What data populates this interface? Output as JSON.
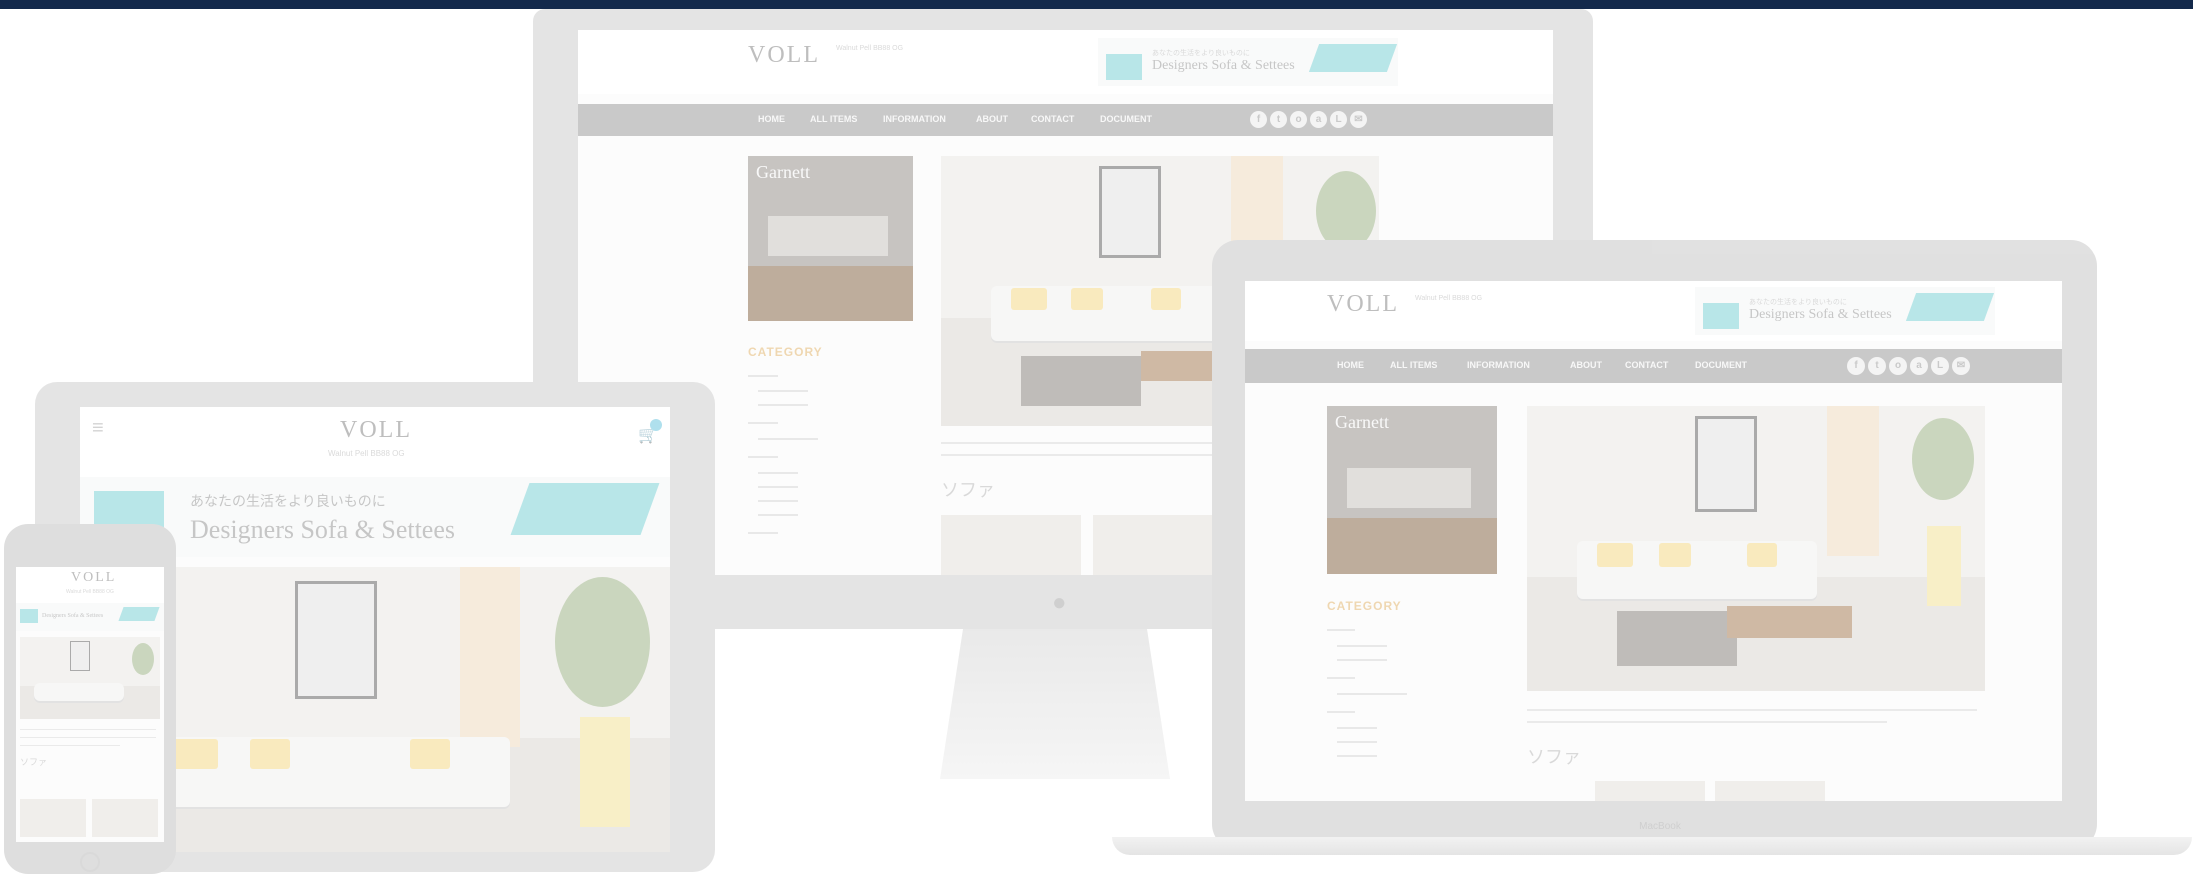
{
  "site": {
    "logo": "VOLL",
    "tagline": "Walnut Pell BB88 OG",
    "banner_title": "Designers Sofa & Settees",
    "banner_sub_jp": "あなたの生活をより良いものに",
    "nav": [
      "HOME",
      "ALL ITEMS",
      "INFORMATION",
      "ABOUT",
      "CONTACT",
      "DOCUMENT"
    ],
    "social_icons": [
      "facebook-icon",
      "twitter-icon",
      "instagram-icon",
      "amazon-icon",
      "line-icon",
      "mail-icon"
    ],
    "social_glyphs": [
      "f",
      "t",
      "o",
      "a",
      "L",
      "✉"
    ],
    "thumb_title": "Garnett",
    "category_title": "CATEGORY",
    "section_title_jp": "ソファ"
  },
  "laptop": {
    "brand": "MacBook"
  },
  "colors": {
    "topbar": "#13294b",
    "nav": "#9e9e9e",
    "accent": "#e3b772",
    "teal": "#7fd3d6"
  }
}
